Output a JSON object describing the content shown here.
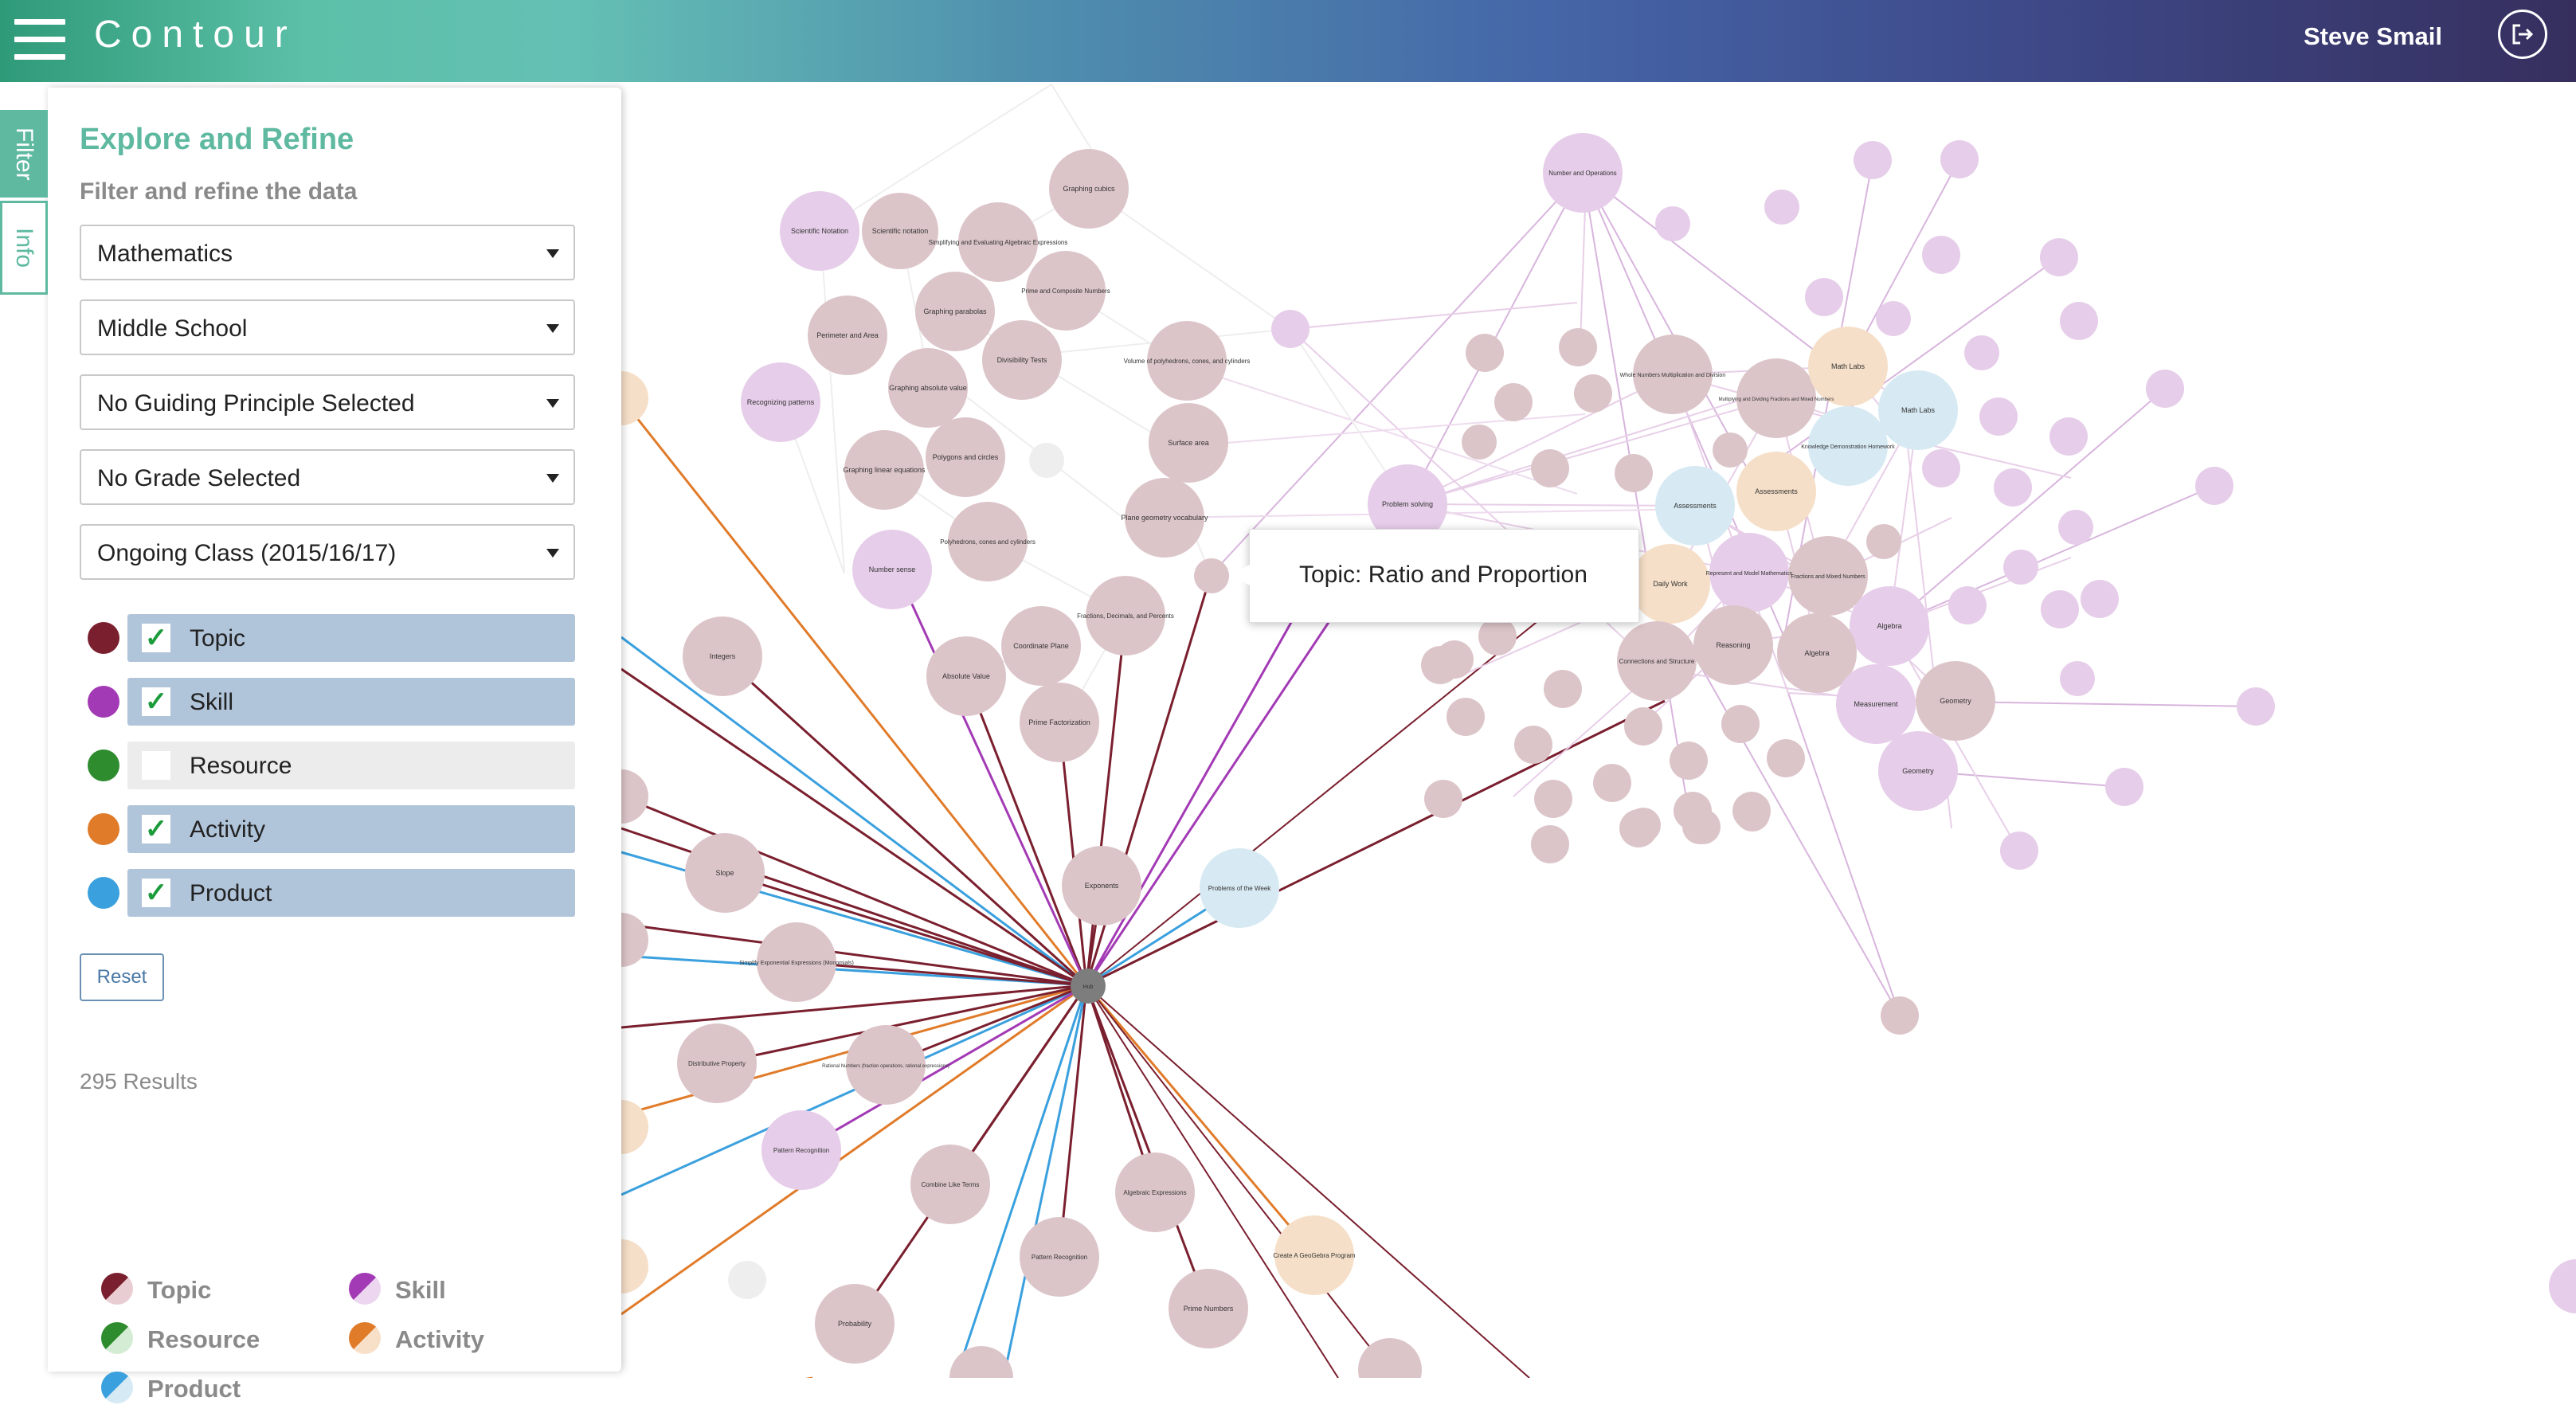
{
  "header": {
    "menu_icon": "hamburger-menu-icon",
    "app_title": "Contour",
    "user_name": "Steve Smail",
    "logout_icon": "logout-icon"
  },
  "side_tabs": {
    "filter_label": "Filter",
    "info_label": "Info"
  },
  "panel": {
    "title": "Explore and Refine",
    "subtitle": "Filter and refine the data",
    "dropdowns": [
      "Mathematics",
      "Middle School",
      "No Guiding Principle Selected",
      "No Grade Selected",
      "Ongoing Class (2015/16/17)"
    ],
    "types": [
      {
        "label": "Topic",
        "checked": true,
        "color": "#7a1f2e"
      },
      {
        "label": "Skill",
        "checked": true,
        "color": "#a33ab5"
      },
      {
        "label": "Resource",
        "checked": false,
        "color": "#2e8b2e"
      },
      {
        "label": "Activity",
        "checked": true,
        "color": "#e07b2a"
      },
      {
        "label": "Product",
        "checked": true,
        "color": "#3aa0de"
      }
    ],
    "reset_label": "Reset",
    "results_count": "295 Results"
  },
  "legend": [
    {
      "label": "Topic",
      "color": "#7a1f2e"
    },
    {
      "label": "Skill",
      "color": "#a33ab5"
    },
    {
      "label": "Resource",
      "color": "#2e8b2e"
    },
    {
      "label": "Activity",
      "color": "#e07b2a"
    },
    {
      "label": "Product",
      "color": "#3aa0de"
    }
  ],
  "tooltip": {
    "text": "Topic: Ratio and Proportion"
  },
  "graph": {
    "hub_label": "Hub",
    "nodes": [
      {
        "label": "Graphing cubics"
      },
      {
        "label": "Scientific Notation"
      },
      {
        "label": "Scientific notation"
      },
      {
        "label": "Simplifying and Evaluating Algebraic Expressions"
      },
      {
        "label": "Prime and Composite Numbers"
      },
      {
        "label": "Graphing parabolas"
      },
      {
        "label": "Perimeter and Area"
      },
      {
        "label": "Divisibility Tests"
      },
      {
        "label": "Volume of polyhedrons, cones, and cylinders"
      },
      {
        "label": "Recognizing patterns"
      },
      {
        "label": "Graphing absolute value"
      },
      {
        "label": "Surface area"
      },
      {
        "label": "Graphing linear equations"
      },
      {
        "label": "Polygons and circles"
      },
      {
        "label": "Plane geometry vocabulary"
      },
      {
        "label": "Polyhedrons, cones and cylinders"
      },
      {
        "label": "Number sense"
      },
      {
        "label": "Fractions, Decimals, and Percents"
      },
      {
        "label": "Coordinate Plane"
      },
      {
        "label": "Integers"
      },
      {
        "label": "Absolute Value"
      },
      {
        "label": "Prime Factorization"
      },
      {
        "label": "Exponents"
      },
      {
        "label": "Problems of the Week"
      },
      {
        "label": "Slope"
      },
      {
        "label": "Simplify Exponential Expressions (Monomials)"
      },
      {
        "label": "Distributive Property"
      },
      {
        "label": "Rational Numbers (fraction operations, rational expressions)"
      },
      {
        "label": "Pattern Recognition"
      },
      {
        "label": "Combine Like Terms"
      },
      {
        "label": "Algebraic Expressions"
      },
      {
        "label": "Pattern Recognition"
      },
      {
        "label": "Create A GeoGebra Program"
      },
      {
        "label": "Prime Numbers"
      },
      {
        "label": "Probability"
      },
      {
        "label": "Problem solving"
      },
      {
        "label": "Number and Operations"
      },
      {
        "label": "Whole Numbers Multiplication and Division"
      },
      {
        "label": "Multiplying and Dividing Fractions and Mixed Numbers"
      },
      {
        "label": "Math Labs"
      },
      {
        "label": "Math Labs"
      },
      {
        "label": "Knowledge Demonstration Homework"
      },
      {
        "label": "Assessments"
      },
      {
        "label": "Assessments"
      },
      {
        "label": "Represent and Model Mathematics"
      },
      {
        "label": "Fractions and Mixed Numbers"
      },
      {
        "label": "Daily Work"
      },
      {
        "label": "Reasoning"
      },
      {
        "label": "Algebra"
      },
      {
        "label": "Algebra"
      },
      {
        "label": "Connections and Structure"
      },
      {
        "label": "Measurement"
      },
      {
        "label": "Geometry"
      },
      {
        "label": "Geometry"
      }
    ]
  }
}
